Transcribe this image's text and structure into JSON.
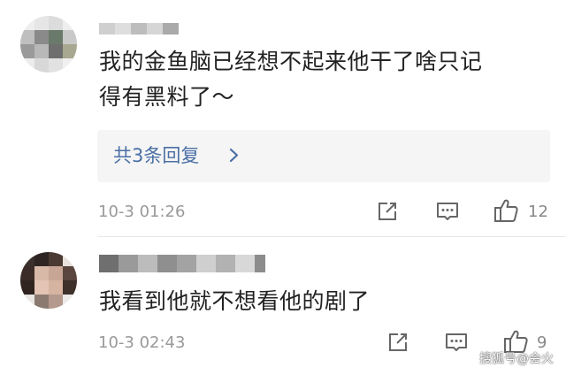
{
  "colors": {
    "background": "#ffffff",
    "text_primary": "#222222",
    "text_secondary": "#999999",
    "reply_link": "#4a6fa5",
    "reply_background": "#f5f5f5",
    "icon_stroke": "#666666"
  },
  "comments": [
    {
      "avatar_icon": "pixelated-avatar",
      "username_icon": "pixelated-username",
      "text_line1": "我的金鱼脑已经想不起来他干了啥只记",
      "text_line2": "得有黑料了～",
      "replies_label": "共3条回复",
      "timestamp": "10-3 01:26",
      "actions": {
        "share_icon": "share-icon",
        "reply_icon": "comment-icon",
        "like_icon": "thumbs-up-icon",
        "like_count": "12"
      }
    },
    {
      "avatar_icon": "pixelated-avatar",
      "username_icon": "pixelated-username",
      "text_line1": "我看到他就不想看他的剧了",
      "timestamp": "10-3 02:43",
      "actions": {
        "share_icon": "share-icon",
        "reply_icon": "comment-icon",
        "like_icon": "thumbs-up-icon",
        "like_count": "9"
      }
    }
  ],
  "watermark": "搜狐号@会火"
}
